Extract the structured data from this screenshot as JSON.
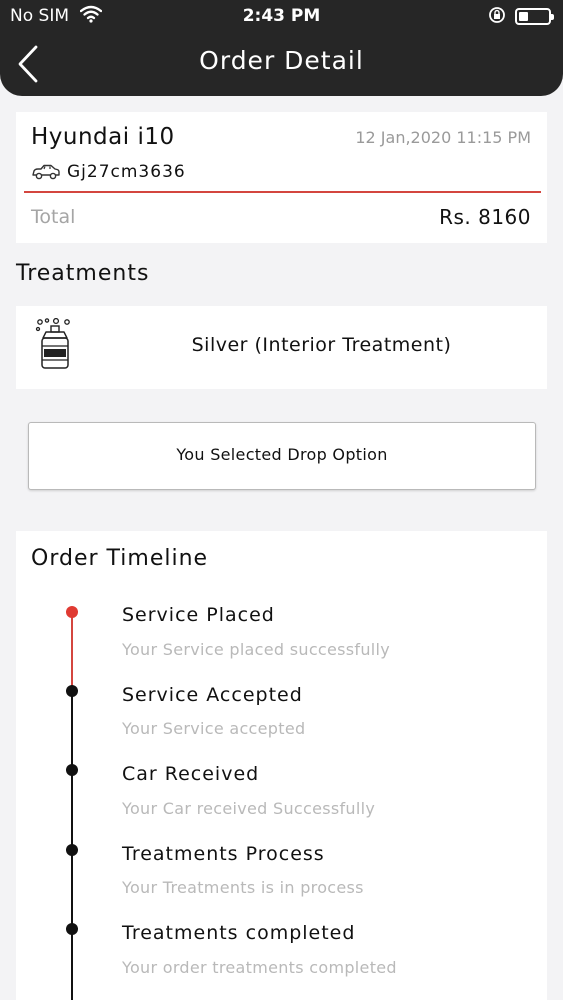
{
  "status_bar": {
    "carrier": "No SIM",
    "time": "2:43 PM"
  },
  "header": {
    "title": "Order Detail",
    "back_icon": "chevron-left-icon"
  },
  "order": {
    "car_name": "Hyundai i10",
    "date": "12 Jan,2020 11:15 PM",
    "plate": "Gj27cm3636",
    "total_label": "Total",
    "total_value": "Rs. 8160"
  },
  "treatments": {
    "title": "Treatments",
    "items": [
      {
        "name": "Silver (Interior Treatment)",
        "icon": "spray-bottle-icon"
      }
    ]
  },
  "drop_option": {
    "text": "You Selected Drop Option"
  },
  "timeline": {
    "title": "Order Timeline",
    "steps": [
      {
        "title": "Service Placed",
        "subtitle": "Your Service placed successfully",
        "active": true
      },
      {
        "title": "Service Accepted",
        "subtitle": "Your Service accepted",
        "active": false
      },
      {
        "title": "Car Received",
        "subtitle": "Your Car received Successfully",
        "active": false
      },
      {
        "title": "Treatments Process",
        "subtitle": "Your Treatments is in process",
        "active": false
      },
      {
        "title": "Treatments completed",
        "subtitle": "Your order treatments completed",
        "active": false
      }
    ]
  },
  "colors": {
    "header_bg": "#262626",
    "accent_red": "#d4463f",
    "muted_text": "#b9b9b9"
  }
}
